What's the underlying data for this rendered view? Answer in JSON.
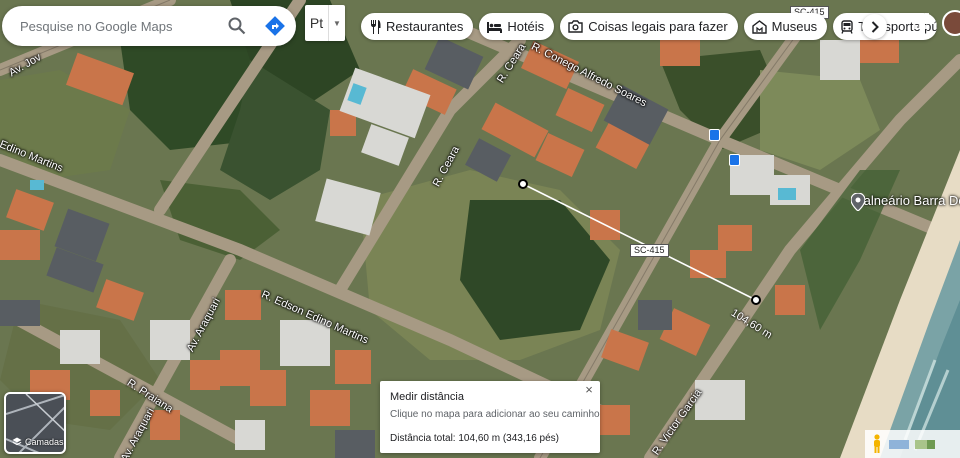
{
  "search": {
    "placeholder": "Pesquise no Google Maps"
  },
  "transit_mode": {
    "label": "Pt"
  },
  "chips": [
    {
      "label": "Restaurantes",
      "icon": "restaurant-icon"
    },
    {
      "label": "Hotéis",
      "icon": "hotel-icon"
    },
    {
      "label": "Coisas legais para fazer",
      "icon": "camera-icon"
    },
    {
      "label": "Museus",
      "icon": "museum-icon"
    },
    {
      "label": "Transporte público",
      "icon": "transit-icon"
    }
  ],
  "streets": {
    "av_jov": "Av. Jov",
    "edino_martins": "Edino Martins",
    "r_ceara_top": "R. Ceara",
    "r_ceara_mid": "R. Ceara",
    "r_conego": "R. Conego Alfredo Soares",
    "r_edson": "R. Edson Edino Martins",
    "av_araquari": "Av. Araquari",
    "av_araquari_2": "Av. Araquari",
    "r_praiana": "R. Praiana",
    "r_victor": "R. Victor Garcia"
  },
  "road_shields": {
    "sc415_top": "SC-415",
    "sc415_mid": "SC-415"
  },
  "poi": {
    "name": "Balneário Barra Do"
  },
  "measure": {
    "distance_label": "104,60 m",
    "card_title": "Medir distância",
    "card_hint": "Clique no mapa para adicionar ao seu caminho",
    "card_total": "Distância total: 104,60 m (343,16 pés)",
    "close_glyph": "×"
  },
  "layers": {
    "label": "Camadas"
  },
  "colors": {
    "accent_blue": "#1a73e8",
    "roof_orange": "#c9754a",
    "vegetation": "#3f5a2c",
    "sand": "#e9dcc3",
    "sea": "#6f9aa0"
  }
}
